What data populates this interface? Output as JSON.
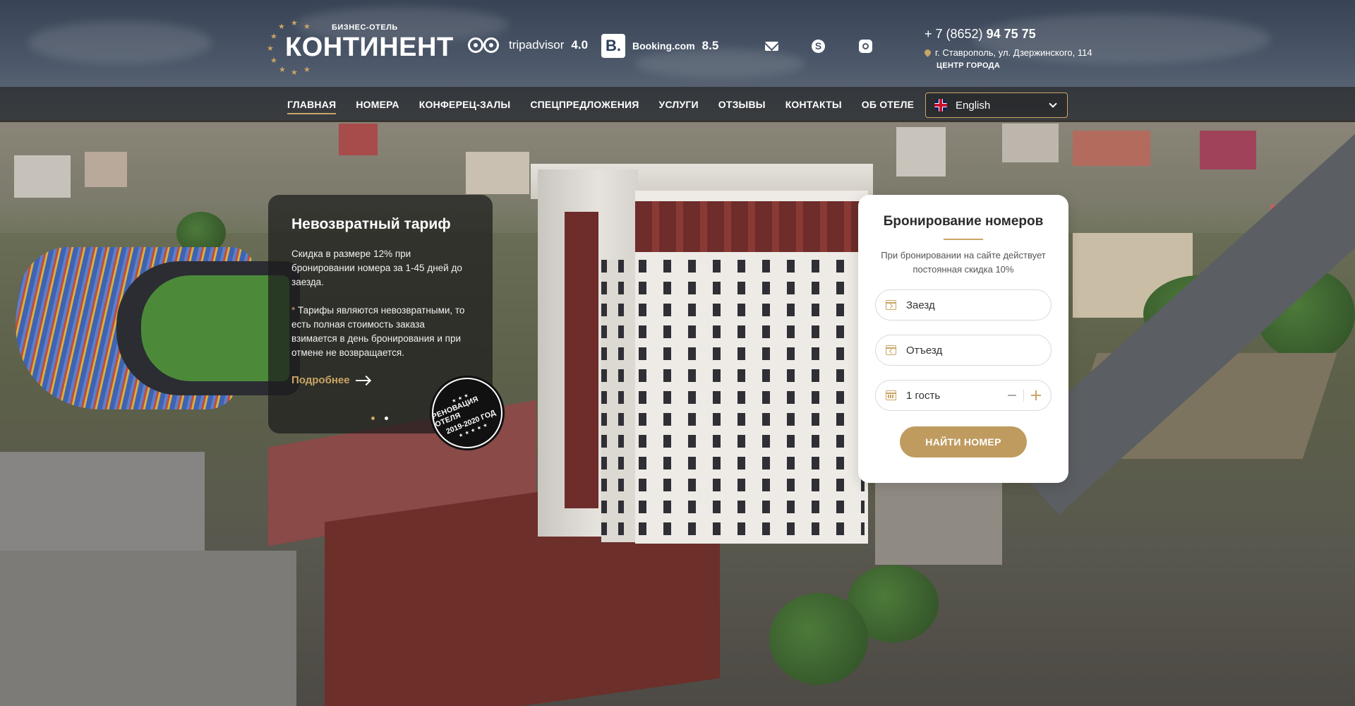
{
  "header": {
    "logo": {
      "small": "БИЗНЕС-ОТЕЛЬ",
      "big": "КОНТИНЕНТ"
    },
    "tripadvisor": {
      "label": "tripadvisor",
      "rating": "4.0"
    },
    "booking": {
      "icon_letter": "B.",
      "label": "Booking.com",
      "rating": "8.5"
    },
    "social_icons": [
      "mail-icon",
      "skype-icon",
      "instagram-icon"
    ],
    "phone_prefix": "+ 7 (8652)",
    "phone_number": "94 75 75",
    "address": "г. Ставрополь, ул. Дзержинского, 114",
    "address_sub": "ЦЕНТР ГОРОДА"
  },
  "nav": {
    "items": [
      {
        "label": "ГЛАВНАЯ",
        "active": true
      },
      {
        "label": "НОМЕРА"
      },
      {
        "label": "КОНФЕРЕЦ-ЗАЛЫ"
      },
      {
        "label": "СПЕЦПРЕДЛОЖЕНИЯ"
      },
      {
        "label": "УСЛУГИ"
      },
      {
        "label": "ОТЗЫВЫ"
      },
      {
        "label": "КОНТАКТЫ"
      },
      {
        "label": "ОБ ОТЕЛЕ"
      }
    ],
    "language": "English"
  },
  "promo": {
    "title": "Невозвратный тариф",
    "text": "Скидка в размере 12% при бронировании номера за 1-45 дней до заезда.",
    "note_star": "*",
    "note": " Тарифы являются невозвратными, то есть полная стоимость заказа взимается в день бронирования и при отмене не возвращается.",
    "link": "Подробнее",
    "slides_total": 2,
    "slide_active": 1
  },
  "badge": {
    "line1": "РЕНОВАЦИЯ ОТЕЛЯ",
    "line2": "2019-2020 ГОД"
  },
  "booking_form": {
    "title": "Бронирование номеров",
    "description": "При бронировании на сайте действует постоянная скидка 10%",
    "checkin_placeholder": "Заезд",
    "checkout_placeholder": "Отъезд",
    "guests": "1 гость",
    "submit": "НАЙТИ НОМЕР"
  },
  "colors": {
    "accent_gold": "#c9a565",
    "button_gold": "#bf9b5f",
    "nav_bg": "#181818"
  }
}
